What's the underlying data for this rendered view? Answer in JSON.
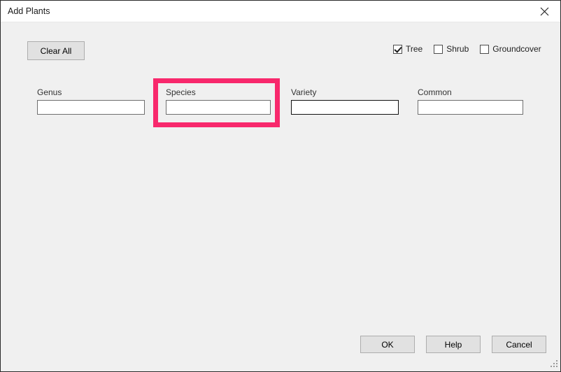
{
  "window": {
    "title": "Add Plants",
    "close_icon": "close-icon",
    "resize_grip_icon": "resize-grip-icon",
    "background_color": "#f0f0f0",
    "titlebar_color": "#ffffff"
  },
  "toolbar": {
    "clear_all_label": "Clear All"
  },
  "plant_type_filters": [
    {
      "label": "Tree",
      "checked": true
    },
    {
      "label": "Shrub",
      "checked": false
    },
    {
      "label": "Groundcover",
      "checked": false
    }
  ],
  "fields": [
    {
      "label": "Genus",
      "value": "",
      "placeholder": "",
      "focused": false
    },
    {
      "label": "Species",
      "value": "",
      "placeholder": "",
      "focused": false
    },
    {
      "label": "Variety",
      "value": "",
      "placeholder": "",
      "focused": true
    },
    {
      "label": "Common",
      "value": "",
      "placeholder": "",
      "focused": false
    }
  ],
  "highlight": {
    "color": "#f8286c",
    "target": "Species"
  },
  "dialog_buttons": [
    {
      "label": "OK"
    },
    {
      "label": "Help"
    },
    {
      "label": "Cancel"
    }
  ]
}
